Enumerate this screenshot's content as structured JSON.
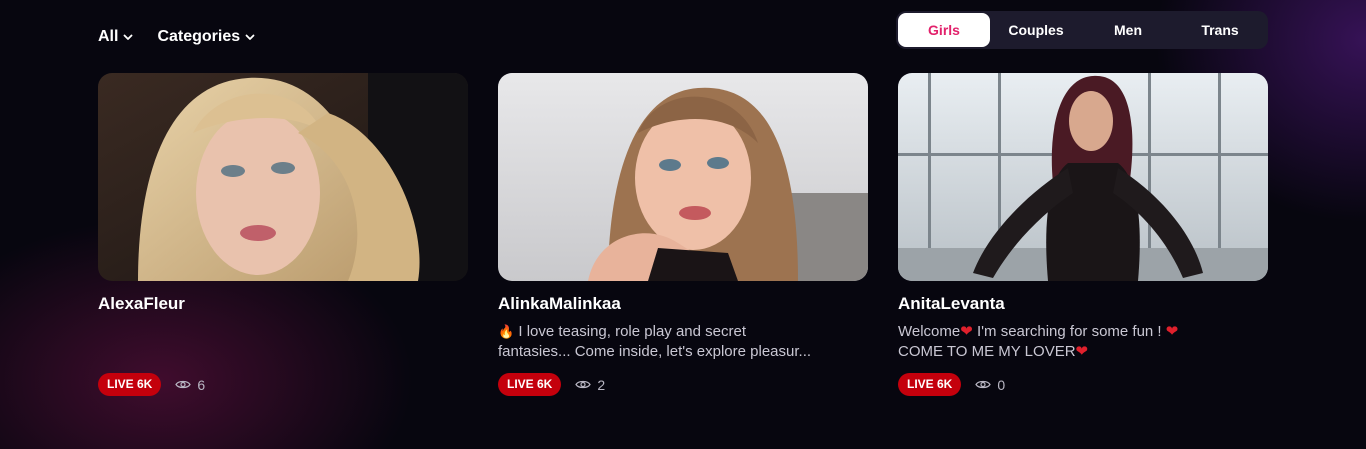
{
  "filters": {
    "all_label": "All",
    "categories_label": "Categories"
  },
  "tabs": [
    {
      "label": "Girls",
      "active": true
    },
    {
      "label": "Couples",
      "active": false
    },
    {
      "label": "Men",
      "active": false
    },
    {
      "label": "Trans",
      "active": false
    }
  ],
  "cards": [
    {
      "name": "AlexaFleur",
      "desc_line1": "",
      "desc_line2": "",
      "live_label": "LIVE 6K",
      "viewers": "6"
    },
    {
      "name": "AlinkaMalinkaa",
      "desc_emoji": "🔥",
      "desc_line1": "I love teasing, role play and secret",
      "desc_line2": "fantasies... Come inside, let's explore pleasur...",
      "live_label": "LIVE 6K",
      "viewers": "2"
    },
    {
      "name": "AnitaLevanta",
      "desc_line1a": "Welcome",
      "desc_line1b": " I'm searching for some fun ! ",
      "desc_line2": "COME TO ME MY LOVER",
      "heart": "❤",
      "live_label": "LIVE 6K",
      "viewers": "0"
    }
  ],
  "colors": {
    "accent_pink": "#e2216b",
    "live_red": "#c4000c",
    "background": "#07060f"
  }
}
